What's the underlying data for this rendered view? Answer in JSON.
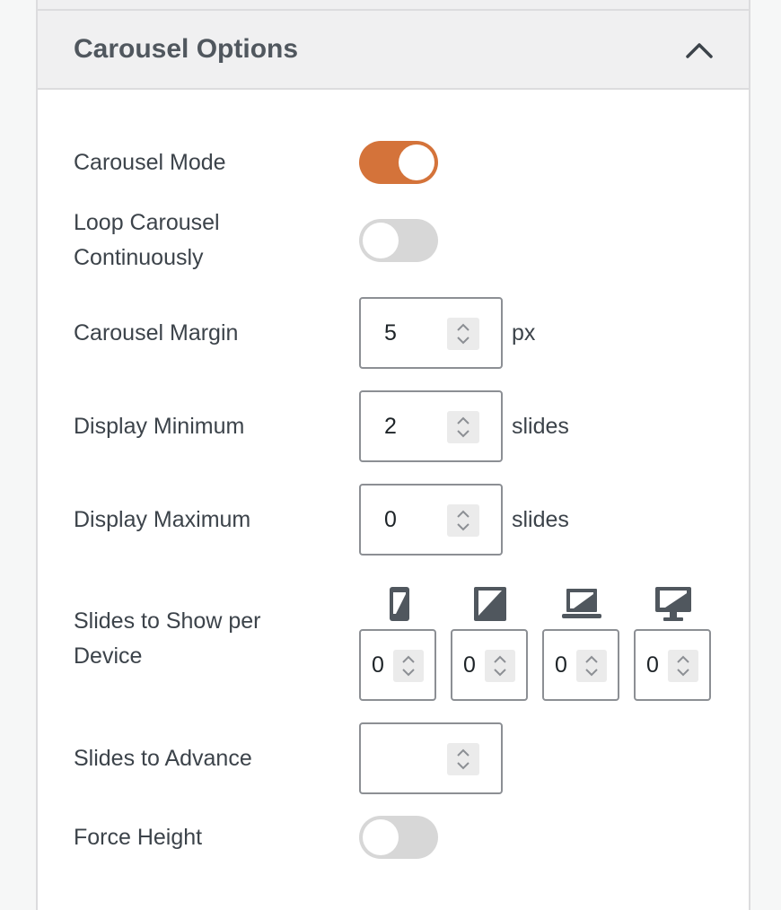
{
  "panel": {
    "title": "Carousel Options",
    "collapse_icon": "chevron-up-icon"
  },
  "fields": {
    "carousel_mode": {
      "label": "Carousel Mode",
      "checked": true
    },
    "loop_carousel": {
      "label_line1": "Loop Carousel",
      "label_line2": "Continuously",
      "checked": false
    },
    "carousel_margin": {
      "label": "Carousel Margin",
      "value": "5",
      "unit": "px"
    },
    "display_minimum": {
      "label": "Display Minimum",
      "value": "2",
      "unit": "slides"
    },
    "display_maximum": {
      "label": "Display Maximum",
      "value": "0",
      "unit": "slides"
    },
    "slides_per_device": {
      "label_line1": "Slides to Show per",
      "label_line2": "Device",
      "devices": [
        {
          "icon": "mobile-icon",
          "value": "0"
        },
        {
          "icon": "tablet-icon",
          "value": "0"
        },
        {
          "icon": "laptop-icon",
          "value": "0"
        },
        {
          "icon": "desktop-icon",
          "value": "0"
        }
      ]
    },
    "slides_to_advance": {
      "label": "Slides to Advance",
      "value": ""
    },
    "force_height": {
      "label": "Force Height",
      "checked": false
    }
  },
  "colors": {
    "toggle_on": "#d4733a",
    "toggle_off": "#d7d7d7",
    "spinner_bg": "#ebebeb"
  }
}
